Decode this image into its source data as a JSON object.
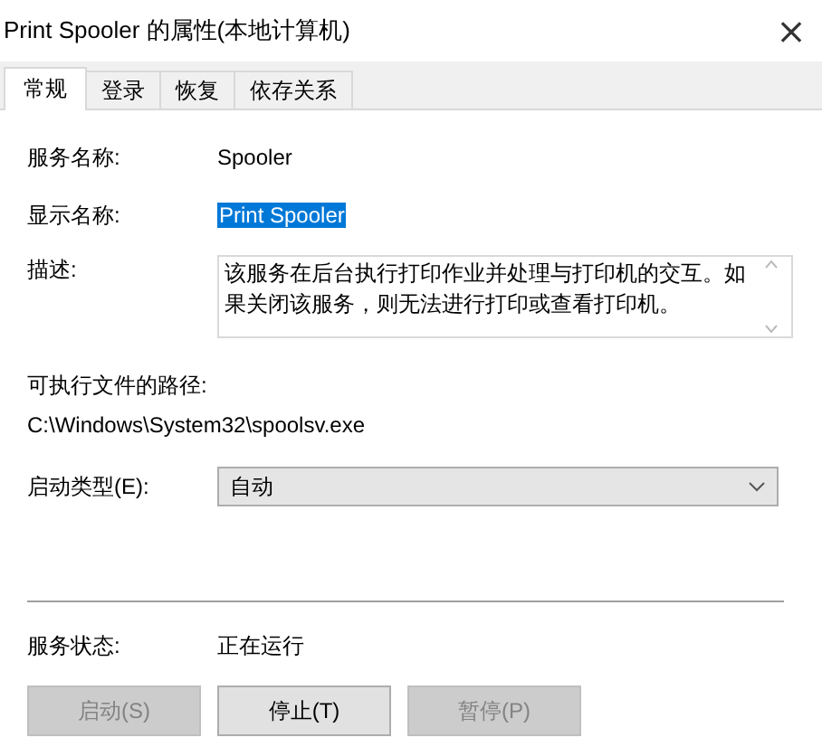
{
  "window": {
    "title": "Print Spooler 的属性(本地计算机)",
    "close": "×"
  },
  "tabs": [
    {
      "label": "常规",
      "selected": true
    },
    {
      "label": "登录",
      "selected": false
    },
    {
      "label": "恢复",
      "selected": false
    },
    {
      "label": "依存关系",
      "selected": false
    }
  ],
  "service_name": {
    "label": "服务名称:",
    "value": "Spooler"
  },
  "display_name": {
    "label": "显示名称:",
    "value": "Print Spooler",
    "selected": true
  },
  "description": {
    "label": "描述:",
    "value": "该服务在后台执行打印作业并处理与打印机的交互。如果关闭该服务，则无法进行打印或查看打印机。"
  },
  "executable_path": {
    "label": "可执行文件的路径:",
    "value": "C:\\Windows\\System32\\spoolsv.exe"
  },
  "startup_type": {
    "label": "启动类型(E):",
    "value": "自动"
  },
  "service_status": {
    "label": "服务状态:",
    "value": "正在运行"
  },
  "buttons": [
    {
      "label": "启动(S)",
      "disabled": true
    },
    {
      "label": "停止(T)",
      "disabled": false
    },
    {
      "label": "暂停(P)",
      "disabled": true
    }
  ]
}
